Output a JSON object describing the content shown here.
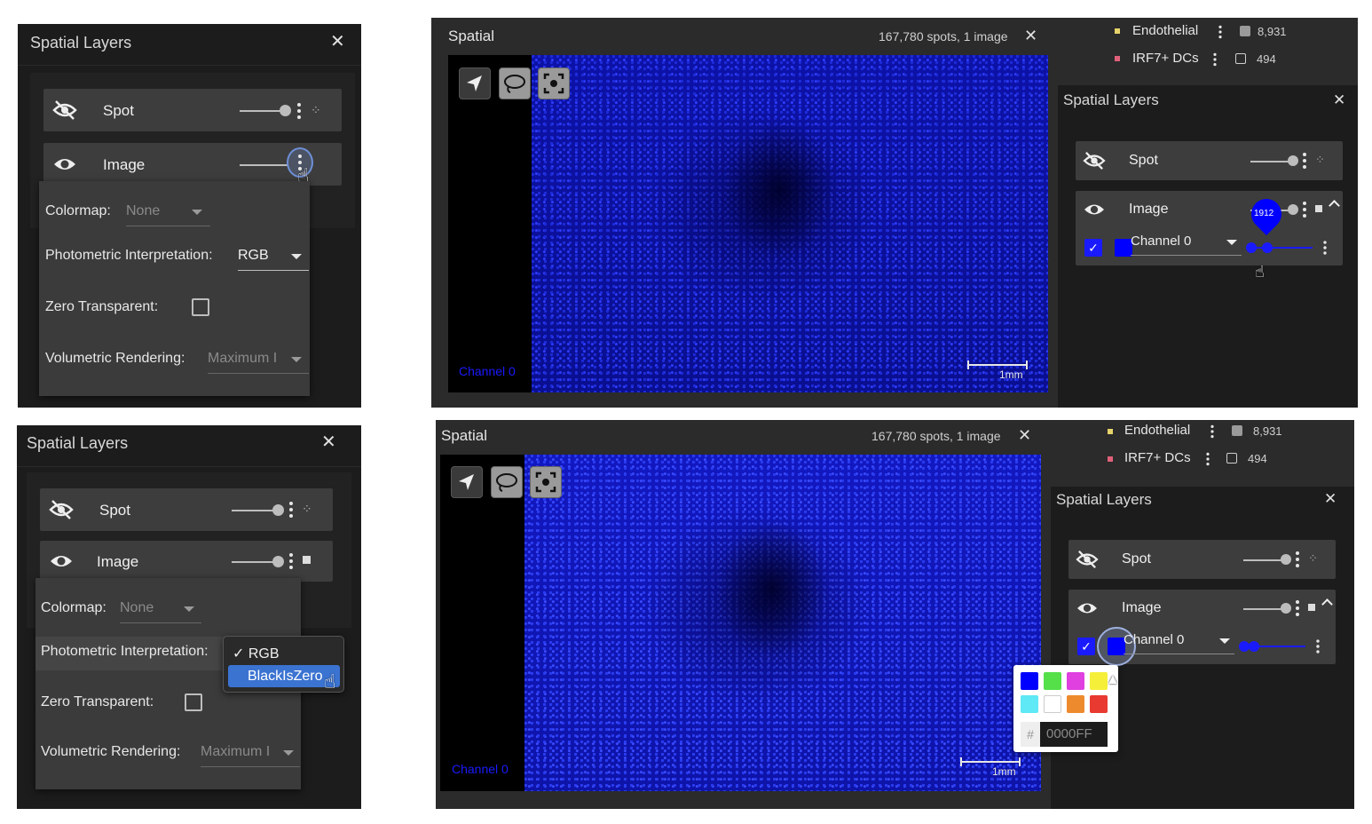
{
  "spatial_layers": {
    "title": "Spatial Layers",
    "close_icon": "close-icon",
    "spot_label": "Spot",
    "image_label": "Image"
  },
  "image_menu": {
    "colormap_label": "Colormap:",
    "colormap_value": "None",
    "photometric_label": "Photometric Interpretation:",
    "photometric_value": "RGB",
    "zero_transparent_label": "Zero Transparent:",
    "volumetric_label": "Volumetric Rendering:",
    "volumetric_value": "Maximum I",
    "photometric_options": [
      "✓ RGB",
      "BlackIsZero"
    ]
  },
  "spatial_view": {
    "title": "Spatial",
    "meta": "167,780 spots, 1 image",
    "channel_overlay": "Channel 0",
    "scale_label": "1mm"
  },
  "legend": [
    {
      "name": "Endothelial",
      "count": "8,931",
      "color": "#e6d36a",
      "box_color": "#9a9a9a"
    },
    {
      "name": "IRF7+ DCs",
      "count": "494",
      "color": "#e0607a",
      "box_color": "transparent"
    }
  ],
  "channel_controls": {
    "channel_name": "Channel 0",
    "slider_value_badge": "1912",
    "color": "#0000FF"
  },
  "color_picker": {
    "swatches": [
      "#0000ff",
      "#55e04a",
      "#e040e0",
      "#f5ef3a",
      "#5fe8f5",
      "#ffffff",
      "#ee8a2e",
      "#e83a30"
    ],
    "hash": "#",
    "hex_value": "0000FF"
  }
}
